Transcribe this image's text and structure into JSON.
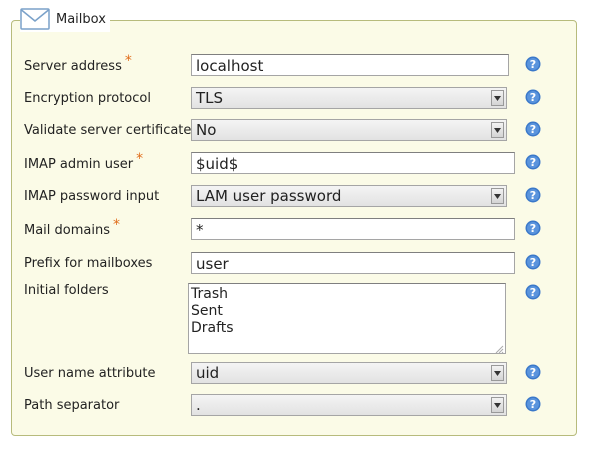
{
  "fieldset": {
    "title": "Mailbox",
    "icon": "mail-envelope-icon"
  },
  "required_mark": "*",
  "fields": {
    "server_address": {
      "label": "Server address",
      "value": "localhost",
      "required": true
    },
    "encryption_protocol": {
      "label": "Encryption protocol",
      "value": "TLS"
    },
    "validate_certificate": {
      "label": "Validate server certificate",
      "value": "No"
    },
    "imap_admin_user": {
      "label": "IMAP admin user",
      "value": "$uid$",
      "required": true
    },
    "imap_password_input": {
      "label": "IMAP password input",
      "value": "LAM user password"
    },
    "mail_domains": {
      "label": "Mail domains",
      "value": "*",
      "required": true
    },
    "prefix_mailboxes": {
      "label": "Prefix for mailboxes",
      "value": "user"
    },
    "initial_folders": {
      "label": "Initial folders",
      "value": "Trash\nSent\nDrafts"
    },
    "user_name_attribute": {
      "label": "User name attribute",
      "value": "uid"
    },
    "path_separator": {
      "label": "Path separator",
      "value": "."
    }
  },
  "colors": {
    "fieldset_bg": "#fbfbe7",
    "fieldset_border": "#b7bb7c",
    "required": "#e06c1a",
    "help_icon": "#3a78c9"
  }
}
